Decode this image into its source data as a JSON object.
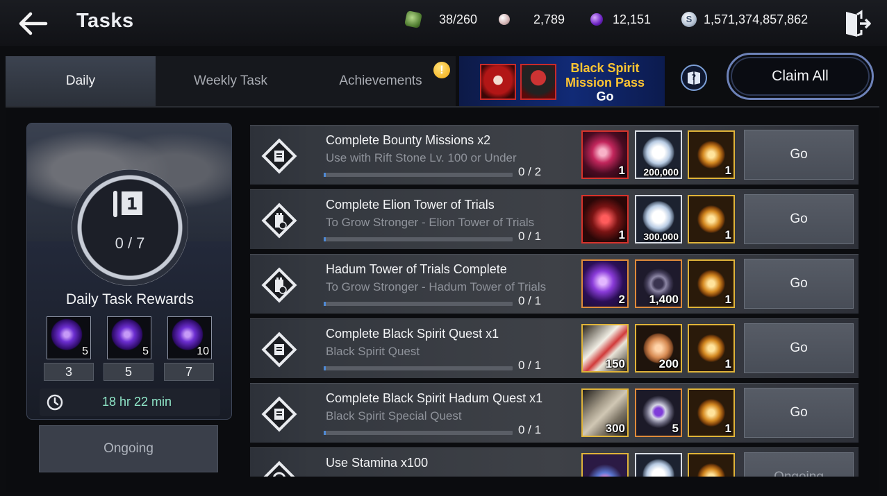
{
  "header": {
    "title": "Tasks",
    "currencies": [
      {
        "icon": "rift-stone-icon",
        "value": "38/260"
      },
      {
        "icon": "pearl-icon",
        "value": "2,789"
      },
      {
        "icon": "purple-orb-icon",
        "value": "12,151"
      },
      {
        "icon": "silver-coin-icon",
        "icon_glyph": "S",
        "value": "1,571,374,857,862"
      }
    ]
  },
  "tabs": [
    {
      "label": "Daily",
      "active": true
    },
    {
      "label": "Weekly Task",
      "active": false
    },
    {
      "label": "Achievements",
      "active": false,
      "alert": "!"
    }
  ],
  "banner": {
    "title": "Black Spirit Mission Pass",
    "action": "Go"
  },
  "claim_all_label": "Claim All",
  "daily_rewards": {
    "progress": "0 / 7",
    "title": "Daily Task Rewards",
    "tiers": [
      {
        "qty": "5",
        "required": "3"
      },
      {
        "qty": "5",
        "required": "5"
      },
      {
        "qty": "10",
        "required": "7"
      }
    ],
    "timer": "18 hr 22 min",
    "status_label": "Ongoing"
  },
  "tasks": [
    {
      "title": "Complete Bounty Missions x2",
      "subtitle": "Use with Rift Stone Lv. 100 or Under",
      "progress": "0 / 2",
      "progress_fraction": 0.0,
      "icon": "scroll-quest-icon",
      "rewards": [
        {
          "art": "red-crystal",
          "qty": "1"
        },
        {
          "art": "silver-coin",
          "qty": "200,000"
        },
        {
          "art": "gold-medal",
          "qty": "1"
        }
      ],
      "action": "Go"
    },
    {
      "title": "Complete Elion Tower of Trials",
      "subtitle": "To Grow Stronger - Elion Tower of Trials",
      "progress": "0 / 1",
      "progress_fraction": 0.0,
      "icon": "tower-icon",
      "rewards": [
        {
          "art": "red-box",
          "qty": "1"
        },
        {
          "art": "silver-coin",
          "qty": "300,000"
        },
        {
          "art": "gold-medal",
          "qty": "1"
        }
      ],
      "action": "Go"
    },
    {
      "title": "Hadum Tower of Trials Complete",
      "subtitle": "To Grow Stronger - Hadum Tower of Trials",
      "progress": "0 / 1",
      "progress_fraction": 0.0,
      "icon": "tower-icon",
      "rewards": [
        {
          "art": "purple-crystal",
          "qty": "2"
        },
        {
          "art": "wheel",
          "qty": "1,400"
        },
        {
          "art": "gold-medal",
          "qty": "1"
        }
      ],
      "action": "Go"
    },
    {
      "title": "Complete Black Spirit Quest x1",
      "subtitle": "Black Spirit Quest",
      "progress": "0 / 1",
      "progress_fraction": 0.0,
      "icon": "scroll-quest-icon",
      "rewards": [
        {
          "art": "scroll",
          "qty": "150"
        },
        {
          "art": "copper-coin",
          "qty": "200"
        },
        {
          "art": "gold-medal",
          "qty": "1"
        }
      ],
      "action": "Go"
    },
    {
      "title": "Complete Black Spirit Hadum Quest x1",
      "subtitle": "Black Spirit Special Quest",
      "progress": "0 / 1",
      "progress_fraction": 0.0,
      "icon": "scroll-quest-icon",
      "rewards": [
        {
          "art": "stone-slab",
          "qty": "300"
        },
        {
          "art": "gem-crest",
          "qty": "5"
        },
        {
          "art": "gold-medal",
          "qty": "1"
        }
      ],
      "action": "Go"
    },
    {
      "title": "Use Stamina x100",
      "subtitle": "",
      "progress": "",
      "progress_fraction": 0.0,
      "icon": "stamina-icon",
      "rewards": [
        {
          "art": "treasure-bag",
          "qty": ""
        },
        {
          "art": "silver-coin",
          "qty": ""
        },
        {
          "art": "gold-medal",
          "qty": ""
        }
      ],
      "action": "Ongoing"
    }
  ],
  "colors": {
    "accent_blue": "#4f8ad6",
    "banner_gold": "#ffc531",
    "timer_green": "#8fe6c8",
    "alert_yellow": "#f3a90f"
  }
}
